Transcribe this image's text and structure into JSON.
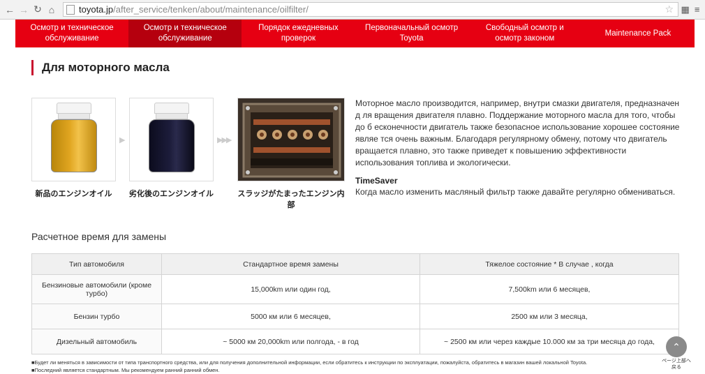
{
  "browser": {
    "url_host": "toyota.jp",
    "url_path": "/after_service/tenken/about/maintenance/oilfilter/"
  },
  "nav": {
    "items": [
      {
        "label": "Осмотр и техническое обслуживание"
      },
      {
        "label": "Осмотр и техническое обслуживание"
      },
      {
        "label": "Порядок ежедневных проверок"
      },
      {
        "label": "Первоначальный осмотр Toyota"
      },
      {
        "label": "Свободный осмотр и осмотр законом"
      },
      {
        "label": "Maintenance Pack"
      }
    ]
  },
  "section_title": "Для моторного масла",
  "images": {
    "new_oil_caption": "新品のエンジンオイル",
    "used_oil_caption": "劣化後のエンジンオイル",
    "sludge_caption": "スラッジがたまったエンジン内部"
  },
  "description": "Моторное масло производится, например, внутри смазки двигателя, предназначен д ля вращения двигателя плавно. Поддержание моторного масла для того, чтобы до б есконечности двигатель также безопасное использование хорошее состояние являе тся очень важным. Благодаря регулярному обмену, потому что двигатель вращается плавно, это также приведет к повышению эффективности использования топлива и экологически.",
  "timesaver": {
    "title": "TimeSaver",
    "text": "Когда масло изменить масляный фильтр также давайте регулярно обмениваться."
  },
  "table": {
    "title": "Расчетное время для замены",
    "headers": [
      "Тип автомобиля",
      "Стандартное время замены",
      "Тяжелое состояние * В случае , когда"
    ],
    "rows": [
      [
        "Бензиновые автомобили (кроме турбо)",
        "15,000km или один год,",
        "7,500km или 6 месяцев,"
      ],
      [
        "Бензин турбо",
        "5000 км или 6 месяцев,",
        "2500 км или 3 месяца,"
      ],
      [
        "Дизельный автомобиль",
        "~ 5000 км 20,000km или полгода, - в год",
        "~ 2500 км или через каждые 10.000 км за три месяца до года,"
      ]
    ]
  },
  "notes": [
    "■Будет ли меняться в зависимости от типа транспортного средства, или для получения дополнительной информации, если обратитесь к инструкции по эксплуатации, пожалуйста, обратитесь в магазин вашей локальной Toyota.",
    "■Последний является стандартным. Мы рекомендуем ранний ранний обмен."
  ],
  "back_to_top_label": "ページ上部へ戻る",
  "colors": {
    "brand_red": "#e60012",
    "active_red": "#b5000e"
  }
}
